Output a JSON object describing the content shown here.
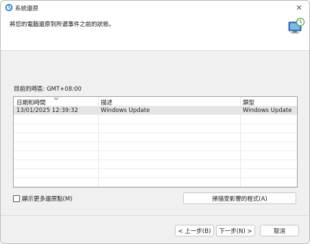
{
  "window": {
    "title": "系統還原",
    "close_glyph": "✕",
    "icon": "system-restore-icon"
  },
  "header": {
    "instruction": "將您的電腦還原到所選事件之前的狀態。",
    "icon": "restore-monitor-icon"
  },
  "timezone": {
    "label": "目前的時區: GMT+08:00"
  },
  "list": {
    "columns": [
      "日期和時間",
      "描述",
      "類型"
    ],
    "rows": [
      {
        "date": "13/01/2025 12:39:32",
        "description": "Windows Update",
        "type": "Windows Update",
        "selected": true
      }
    ]
  },
  "options": {
    "show_more_label": "顯示更多還原點(M)",
    "show_more_checked": false
  },
  "buttons": {
    "scan": "掃描受影響的程式(A)",
    "back": "< 上一步(B)",
    "next": "下一步(N) >",
    "cancel": "取消"
  },
  "colors": {
    "selected_row": "#e5e5e5",
    "window_bg": "#f0f0f0",
    "accent": "#2f7fd8"
  }
}
